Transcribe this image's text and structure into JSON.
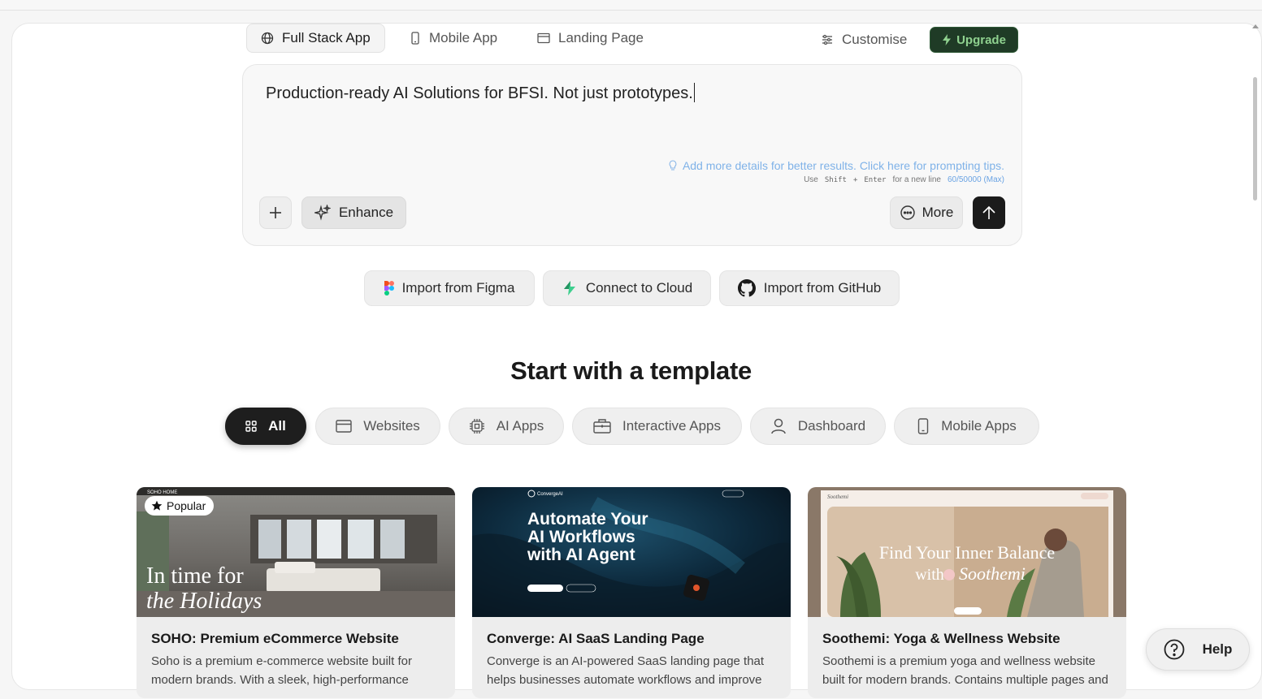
{
  "tabs": [
    {
      "label": "Full Stack App",
      "icon": "globe-icon",
      "active": true
    },
    {
      "label": "Mobile App",
      "icon": "phone-icon",
      "active": false
    },
    {
      "label": "Landing Page",
      "icon": "browser-window-icon",
      "active": false
    }
  ],
  "toolbar": {
    "customise_label": "Customise",
    "upgrade_label": "Upgrade"
  },
  "prompt": {
    "text": "Production-ready AI Solutions for BFSI. Not just prototypes.",
    "tip": "Add more details for better results. Click here for prompting tips.",
    "hint_use": "Use",
    "hint_key1": "Shift",
    "hint_plus": "+",
    "hint_key2": "Enter",
    "hint_suffix": "for a new line",
    "char_count": "60/50000 (Max)",
    "enhance_label": "Enhance",
    "more_label": "More"
  },
  "imports": [
    {
      "label": "Import from Figma",
      "icon": "figma-icon"
    },
    {
      "label": "Connect to Cloud",
      "icon": "lightning-icon"
    },
    {
      "label": "Import from GitHub",
      "icon": "github-icon"
    }
  ],
  "templates": {
    "heading": "Start with a template",
    "filters": [
      {
        "label": "All",
        "icon": "grid-icon",
        "active": true
      },
      {
        "label": "Websites",
        "icon": "browser-window-icon",
        "active": false
      },
      {
        "label": "AI Apps",
        "icon": "chip-icon",
        "active": false
      },
      {
        "label": "Interactive Apps",
        "icon": "briefcase-icon",
        "active": false
      },
      {
        "label": "Dashboard",
        "icon": "user-icon",
        "active": false
      },
      {
        "label": "Mobile Apps",
        "icon": "phone-icon",
        "active": false
      }
    ],
    "cards": [
      {
        "title": "SOHO: Premium eCommerce Website",
        "description": "Soho is a premium e-commerce website built for modern brands. With a sleek, high-performance",
        "badge": "Popular",
        "preview_brand": "SOHO HOME",
        "preview_headline_1": "In time for",
        "preview_headline_2": "the Holidays"
      },
      {
        "title": "Converge: AI SaaS Landing Page",
        "description": "Converge is an AI-powered SaaS landing page that helps businesses automate workflows and improve",
        "preview_brand": "ConvergeAI",
        "preview_headline": "Automate Your AI Workflows with AI Agent"
      },
      {
        "title": "Soothemi: Yoga & Wellness Website",
        "description": "Soothemi is a premium yoga and wellness website built for modern brands. Contains multiple pages and",
        "preview_brand": "Soothemi",
        "preview_headline_1": "Find Your Inner Balance",
        "preview_headline_2": "with",
        "preview_headline_3": "Soothemi"
      }
    ]
  },
  "help_label": "Help",
  "colors": {
    "accent_dark": "#1e1e1e",
    "upgrade_bg": "#1f3b26",
    "upgrade_text": "#8fd18f",
    "tip_blue": "#7fb2e8"
  }
}
